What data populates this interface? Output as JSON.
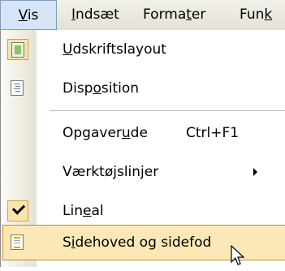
{
  "menubar": {
    "items": [
      {
        "pre": "",
        "mn": "V",
        "post": "is"
      },
      {
        "pre": "",
        "mn": "I",
        "post": "ndsæt"
      },
      {
        "pre": "Forma",
        "mn": "t",
        "post": "er"
      },
      {
        "pre": "Fun",
        "mn": "k",
        "post": ""
      }
    ]
  },
  "menu": {
    "items": [
      {
        "pre": "",
        "mn": "U",
        "post": "dskriftslayout",
        "shortcut": "",
        "icon": "print-layout-icon"
      },
      {
        "pre": "Disp",
        "mn": "o",
        "post": "sition",
        "shortcut": "",
        "icon": "outline-view-icon"
      },
      {
        "pre": "Opgaver",
        "mn": "u",
        "post": "de",
        "shortcut": "Ctrl+F1",
        "icon": ""
      },
      {
        "pre": "Værktø",
        "mn": "j",
        "post": "slinjer",
        "shortcut": "",
        "icon": "submenu-arrow-icon"
      },
      {
        "pre": "Lin",
        "mn": "e",
        "post": "al",
        "shortcut": "",
        "icon": "check-icon"
      },
      {
        "pre": "S",
        "mn": "i",
        "post": "dehoved og sidefod",
        "shortcut": "",
        "icon": "header-footer-icon"
      }
    ]
  },
  "colors": {
    "highlight_fill": "#fbe8b6",
    "highlight_border": "#c98a26",
    "active_menu_fill": "#d6e4f7"
  }
}
